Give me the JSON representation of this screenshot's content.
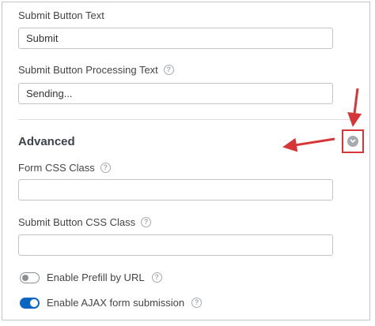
{
  "fields": {
    "submit_text": {
      "label": "Submit Button Text",
      "value": "Submit"
    },
    "processing_text": {
      "label": "Submit Button Processing Text",
      "value": "Sending...",
      "help": "?"
    }
  },
  "advanced": {
    "title": "Advanced",
    "toggle_icon": "chevron-down-circle-icon",
    "form_css_class": {
      "label": "Form CSS Class",
      "value": "",
      "help": "?"
    },
    "submit_css_class": {
      "label": "Submit Button CSS Class",
      "value": "",
      "help": "?"
    },
    "prefill": {
      "label": "Enable Prefill by URL",
      "enabled": false,
      "help": "?"
    },
    "ajax": {
      "label": "Enable AJAX form submission",
      "enabled": true,
      "help": "?"
    }
  },
  "colors": {
    "annotation_red": "#d63638",
    "toggle_on": "#0a66c2",
    "border": "#c3c4c7"
  }
}
